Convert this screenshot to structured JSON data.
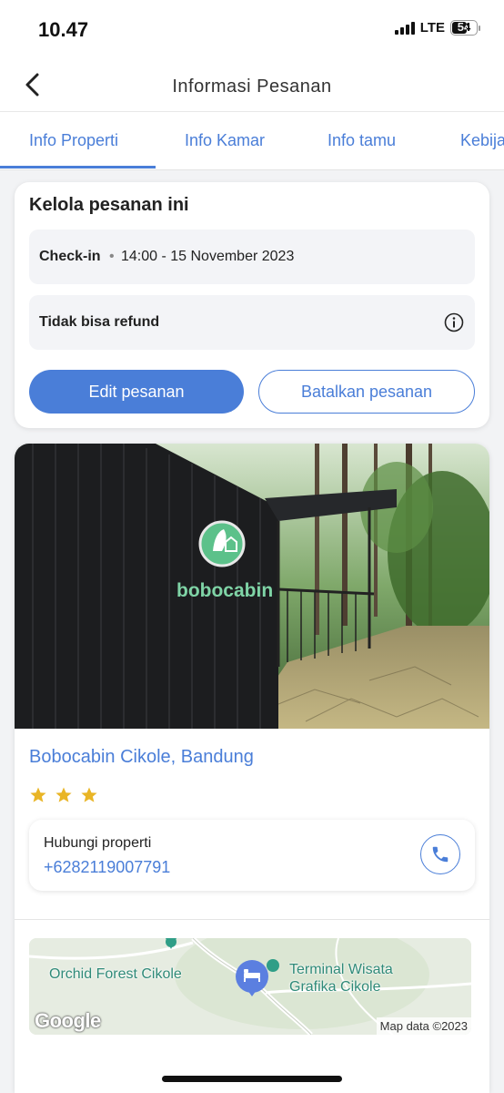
{
  "status_bar": {
    "time": "10.47",
    "network": "LTE",
    "battery": "54"
  },
  "header": {
    "title": "Informasi Pesanan",
    "back_icon": "chevron-left-icon"
  },
  "tabs": [
    {
      "label": "Info Properti",
      "active": true
    },
    {
      "label": "Info Kamar",
      "active": false
    },
    {
      "label": "Info tamu",
      "active": false
    },
    {
      "label": "Kebija",
      "active": false
    }
  ],
  "manage_booking": {
    "title": "Kelola pesanan ini",
    "checkin": {
      "label": "Check-in",
      "separator": "•",
      "value": "14:00 - 15 November 2023"
    },
    "refund": {
      "label": "Tidak bisa refund",
      "icon": "info-icon"
    },
    "edit_button": "Edit pesanan",
    "cancel_button": "Batalkan pesanan"
  },
  "property": {
    "photo_sign": "bobocabin",
    "name": "Bobocabin Cikole, Bandung",
    "star_rating": 3,
    "contact": {
      "label": "Hubungi properti",
      "phone": "+6282119007791",
      "icon": "phone-icon"
    },
    "map": {
      "labels": [
        "Orchid Forest Cikole",
        "Terminal Wisata",
        "Grafika Cikole"
      ],
      "google_logo": "Google",
      "attribution": "Map data ©2023"
    }
  },
  "colors": {
    "accent": "#4a7ed8",
    "star": "#e9b526",
    "background": "#f2f3f5"
  }
}
